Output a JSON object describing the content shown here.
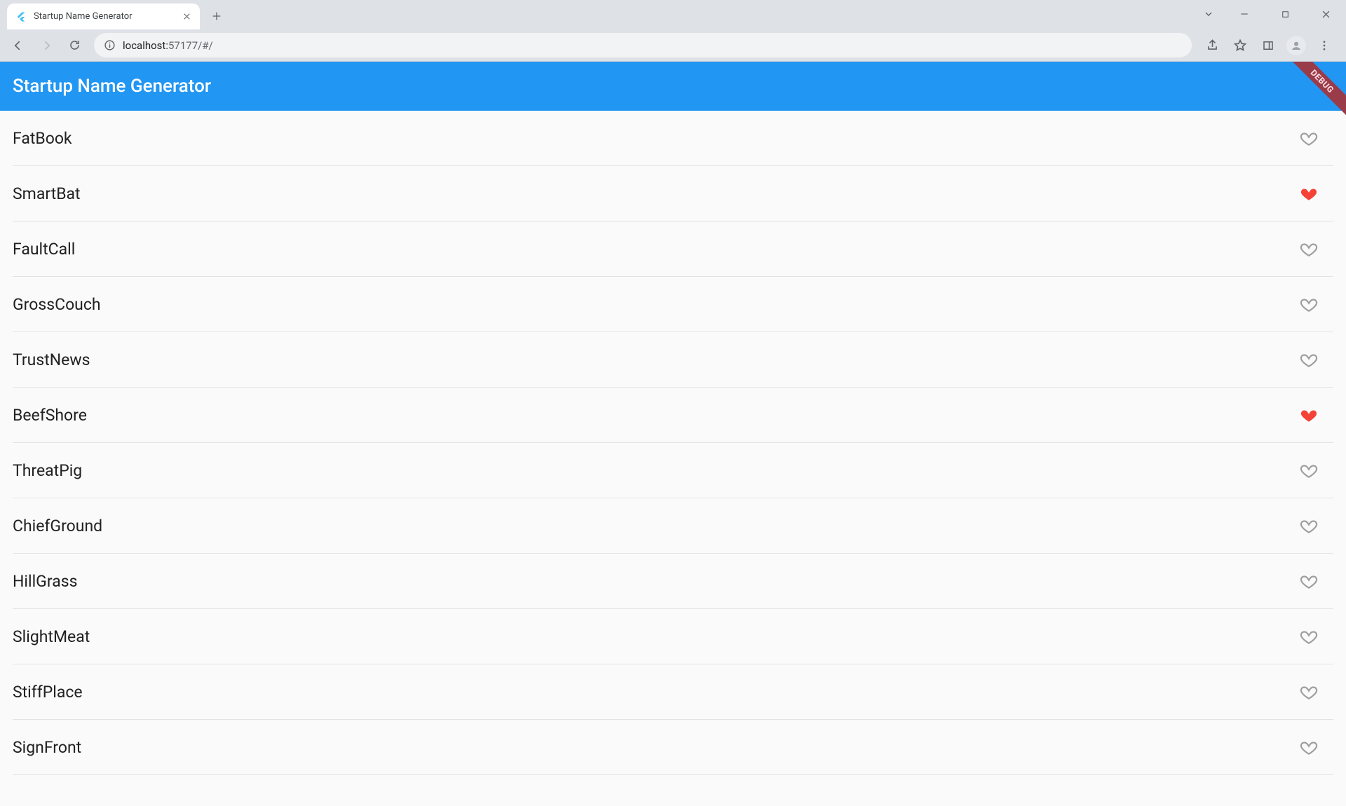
{
  "browser": {
    "tab_title": "Startup Name Generator",
    "url_host": "localhost:",
    "url_rest": "57177/#/"
  },
  "app": {
    "title": "Startup Name Generator",
    "debug_label": "DEBUG",
    "accent": "#2196f3",
    "heart_color": "#f44336"
  },
  "names": [
    {
      "label": "FatBook",
      "favorited": false
    },
    {
      "label": "SmartBat",
      "favorited": true
    },
    {
      "label": "FaultCall",
      "favorited": false
    },
    {
      "label": "GrossCouch",
      "favorited": false
    },
    {
      "label": "TrustNews",
      "favorited": false
    },
    {
      "label": "BeefShore",
      "favorited": true
    },
    {
      "label": "ThreatPig",
      "favorited": false
    },
    {
      "label": "ChiefGround",
      "favorited": false
    },
    {
      "label": "HillGrass",
      "favorited": false
    },
    {
      "label": "SlightMeat",
      "favorited": false
    },
    {
      "label": "StiffPlace",
      "favorited": false
    },
    {
      "label": "SignFront",
      "favorited": false
    }
  ]
}
